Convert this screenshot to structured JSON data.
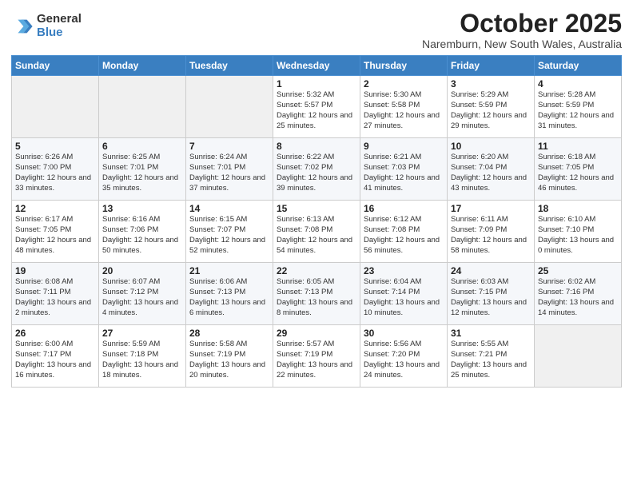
{
  "header": {
    "logo_general": "General",
    "logo_blue": "Blue",
    "title": "October 2025",
    "location": "Naremburn, New South Wales, Australia"
  },
  "days_of_week": [
    "Sunday",
    "Monday",
    "Tuesday",
    "Wednesday",
    "Thursday",
    "Friday",
    "Saturday"
  ],
  "weeks": [
    [
      {
        "day": "",
        "info": ""
      },
      {
        "day": "",
        "info": ""
      },
      {
        "day": "",
        "info": ""
      },
      {
        "day": "1",
        "info": "Sunrise: 5:32 AM\nSunset: 5:57 PM\nDaylight: 12 hours\nand 25 minutes."
      },
      {
        "day": "2",
        "info": "Sunrise: 5:30 AM\nSunset: 5:58 PM\nDaylight: 12 hours\nand 27 minutes."
      },
      {
        "day": "3",
        "info": "Sunrise: 5:29 AM\nSunset: 5:59 PM\nDaylight: 12 hours\nand 29 minutes."
      },
      {
        "day": "4",
        "info": "Sunrise: 5:28 AM\nSunset: 5:59 PM\nDaylight: 12 hours\nand 31 minutes."
      }
    ],
    [
      {
        "day": "5",
        "info": "Sunrise: 6:26 AM\nSunset: 7:00 PM\nDaylight: 12 hours\nand 33 minutes."
      },
      {
        "day": "6",
        "info": "Sunrise: 6:25 AM\nSunset: 7:01 PM\nDaylight: 12 hours\nand 35 minutes."
      },
      {
        "day": "7",
        "info": "Sunrise: 6:24 AM\nSunset: 7:01 PM\nDaylight: 12 hours\nand 37 minutes."
      },
      {
        "day": "8",
        "info": "Sunrise: 6:22 AM\nSunset: 7:02 PM\nDaylight: 12 hours\nand 39 minutes."
      },
      {
        "day": "9",
        "info": "Sunrise: 6:21 AM\nSunset: 7:03 PM\nDaylight: 12 hours\nand 41 minutes."
      },
      {
        "day": "10",
        "info": "Sunrise: 6:20 AM\nSunset: 7:04 PM\nDaylight: 12 hours\nand 43 minutes."
      },
      {
        "day": "11",
        "info": "Sunrise: 6:18 AM\nSunset: 7:05 PM\nDaylight: 12 hours\nand 46 minutes."
      }
    ],
    [
      {
        "day": "12",
        "info": "Sunrise: 6:17 AM\nSunset: 7:05 PM\nDaylight: 12 hours\nand 48 minutes."
      },
      {
        "day": "13",
        "info": "Sunrise: 6:16 AM\nSunset: 7:06 PM\nDaylight: 12 hours\nand 50 minutes."
      },
      {
        "day": "14",
        "info": "Sunrise: 6:15 AM\nSunset: 7:07 PM\nDaylight: 12 hours\nand 52 minutes."
      },
      {
        "day": "15",
        "info": "Sunrise: 6:13 AM\nSunset: 7:08 PM\nDaylight: 12 hours\nand 54 minutes."
      },
      {
        "day": "16",
        "info": "Sunrise: 6:12 AM\nSunset: 7:08 PM\nDaylight: 12 hours\nand 56 minutes."
      },
      {
        "day": "17",
        "info": "Sunrise: 6:11 AM\nSunset: 7:09 PM\nDaylight: 12 hours\nand 58 minutes."
      },
      {
        "day": "18",
        "info": "Sunrise: 6:10 AM\nSunset: 7:10 PM\nDaylight: 13 hours\nand 0 minutes."
      }
    ],
    [
      {
        "day": "19",
        "info": "Sunrise: 6:08 AM\nSunset: 7:11 PM\nDaylight: 13 hours\nand 2 minutes."
      },
      {
        "day": "20",
        "info": "Sunrise: 6:07 AM\nSunset: 7:12 PM\nDaylight: 13 hours\nand 4 minutes."
      },
      {
        "day": "21",
        "info": "Sunrise: 6:06 AM\nSunset: 7:13 PM\nDaylight: 13 hours\nand 6 minutes."
      },
      {
        "day": "22",
        "info": "Sunrise: 6:05 AM\nSunset: 7:13 PM\nDaylight: 13 hours\nand 8 minutes."
      },
      {
        "day": "23",
        "info": "Sunrise: 6:04 AM\nSunset: 7:14 PM\nDaylight: 13 hours\nand 10 minutes."
      },
      {
        "day": "24",
        "info": "Sunrise: 6:03 AM\nSunset: 7:15 PM\nDaylight: 13 hours\nand 12 minutes."
      },
      {
        "day": "25",
        "info": "Sunrise: 6:02 AM\nSunset: 7:16 PM\nDaylight: 13 hours\nand 14 minutes."
      }
    ],
    [
      {
        "day": "26",
        "info": "Sunrise: 6:00 AM\nSunset: 7:17 PM\nDaylight: 13 hours\nand 16 minutes."
      },
      {
        "day": "27",
        "info": "Sunrise: 5:59 AM\nSunset: 7:18 PM\nDaylight: 13 hours\nand 18 minutes."
      },
      {
        "day": "28",
        "info": "Sunrise: 5:58 AM\nSunset: 7:19 PM\nDaylight: 13 hours\nand 20 minutes."
      },
      {
        "day": "29",
        "info": "Sunrise: 5:57 AM\nSunset: 7:19 PM\nDaylight: 13 hours\nand 22 minutes."
      },
      {
        "day": "30",
        "info": "Sunrise: 5:56 AM\nSunset: 7:20 PM\nDaylight: 13 hours\nand 24 minutes."
      },
      {
        "day": "31",
        "info": "Sunrise: 5:55 AM\nSunset: 7:21 PM\nDaylight: 13 hours\nand 25 minutes."
      },
      {
        "day": "",
        "info": ""
      }
    ]
  ]
}
